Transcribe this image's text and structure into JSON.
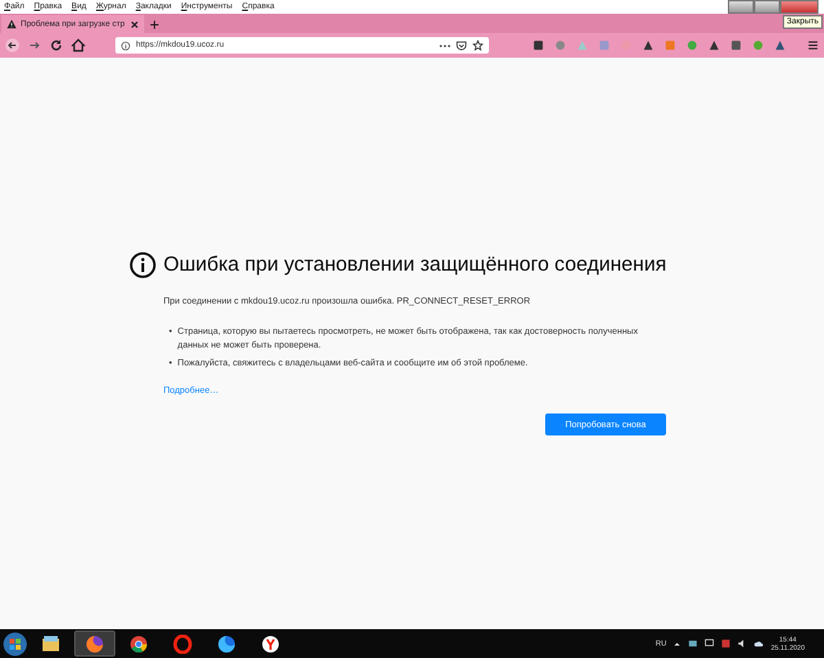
{
  "menu_bar": {
    "items": [
      "Файл",
      "Правка",
      "Вид",
      "Журнал",
      "Закладки",
      "Инструменты",
      "Справка"
    ]
  },
  "window_tooltip": "Закрыть",
  "tabs": [
    {
      "title": "Проблема при загрузке стр",
      "selected": true
    }
  ],
  "new_tab": "+",
  "address_bar": {
    "url": "https://mkdou19.ucoz.ru"
  },
  "error_page": {
    "title": "Ошибка при установлении защищённого соединения",
    "description": "При соединении с mkdou19.ucoz.ru произошла ошибка. PR_CONNECT_RESET_ERROR",
    "bullets": [
      "Страница, которую вы пытаетесь просмотреть, не может быть отображена, так как достоверность полученных данных не может быть проверена.",
      "Пожалуйста, свяжитесь с владельцами веб-сайта и сообщите им об этой проблеме."
    ],
    "bullet_marker": "•",
    "link": "Подробнее…",
    "button": "Попробовать снова"
  },
  "taskbar": {
    "apps": [
      {
        "kind": "explorer",
        "selected": false
      },
      {
        "kind": "firefox",
        "selected": true
      },
      {
        "kind": "chrome",
        "selected": false
      },
      {
        "kind": "opera",
        "selected": false
      },
      {
        "kind": "firefox-blue",
        "selected": false
      },
      {
        "kind": "yandex",
        "selected": false
      }
    ],
    "language": "RU",
    "time": "15:44",
    "date": "25.11.2020"
  }
}
